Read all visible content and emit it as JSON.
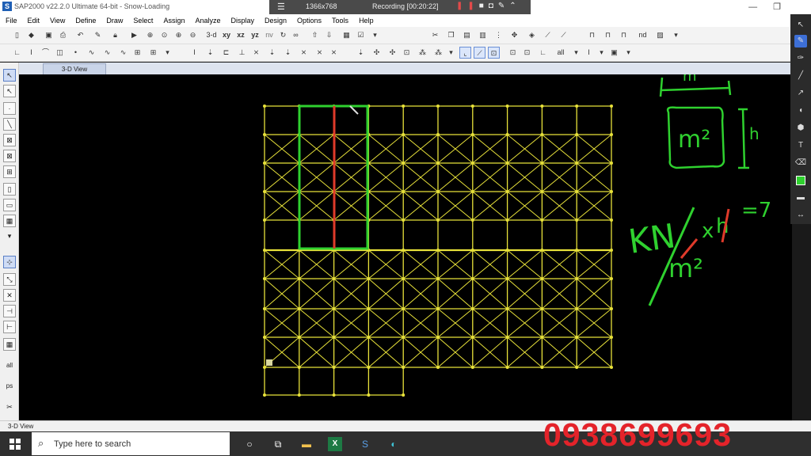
{
  "window": {
    "title": "SAP2000 v22.2.0 Ultimate 64-bit - Snow-Loading"
  },
  "recorder": {
    "resolution": "1366x768",
    "status": "Recording [00:20:22]"
  },
  "menu": [
    "File",
    "Edit",
    "View",
    "Define",
    "Draw",
    "Select",
    "Assign",
    "Analyze",
    "Display",
    "Design",
    "Options",
    "Tools",
    "Help"
  ],
  "toolbar": {
    "view_3d": "3-d",
    "view_xy": "xy",
    "view_xz": "xz",
    "view_yz": "yz",
    "view_nv": "nv",
    "view_all": "all"
  },
  "tabs": {
    "active": "3-D View"
  },
  "statusbar": {
    "text": "3-D View"
  },
  "annotations": {
    "width_label": "m",
    "area_label": "m²",
    "height_label": "h",
    "formula_num": "KN",
    "formula_den": "m²",
    "formula_times": "x",
    "formula_h": "h",
    "formula_result": "=7"
  },
  "taskbar": {
    "search_placeholder": "Type here to search"
  },
  "overlay": {
    "phone": "0938699693"
  },
  "colors": {
    "frame": "#e8e23a",
    "highlight_green": "#2fd12f",
    "highlight_red": "#e03a2a",
    "canvas": "#000000",
    "phone": "#e4232a"
  },
  "model": {
    "bays": 10,
    "levels": 9,
    "braced_pattern": "x-bracing",
    "highlighted_bay": 2
  }
}
